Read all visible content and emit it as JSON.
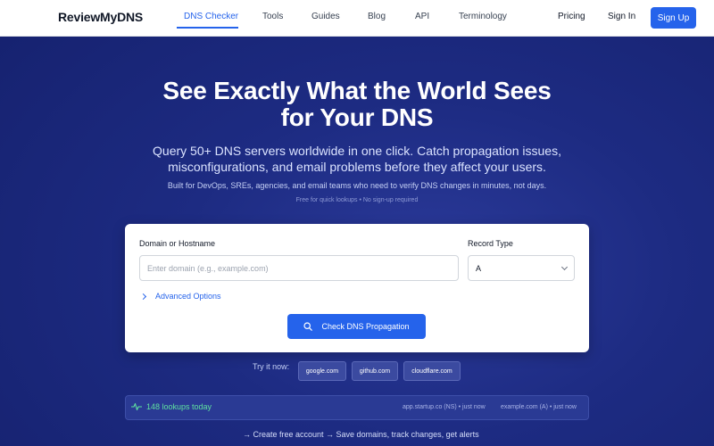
{
  "nav": {
    "brand": "ReviewMyDNS",
    "links": [
      "DNS Checker",
      "Tools",
      "Guides",
      "Blog",
      "API",
      "Terminology"
    ],
    "pricing": "Pricing",
    "sign_in": "Sign In",
    "sign_up": "Sign Up"
  },
  "hero": {
    "title_line1": "See Exactly What the World Sees",
    "title_line2": "for Your DNS",
    "subtitle_line1": "Query 50+ DNS servers worldwide in one click. Catch propagation issues,",
    "subtitle_line2": "misconfigurations, and email problems before they affect your users.",
    "built_for": "Built for DevOps, SREs, agencies, and email teams who need to verify DNS changes in minutes, not days.",
    "free_note": "Free for quick lookups • No sign-up required"
  },
  "form": {
    "domain_label": "Domain or Hostname",
    "domain_placeholder": "Enter domain (e.g., example.com)",
    "record_label": "Record Type",
    "record_value": "A",
    "advanced": "Advanced Options",
    "submit": "Check DNS Propagation"
  },
  "try_now": {
    "label": "Try it now:",
    "examples": [
      "google.com",
      "github.com",
      "cloudflare.com"
    ]
  },
  "activity": {
    "lookups": "148 lookups today",
    "recent": [
      "app.startup.co (NS) • just now",
      "example.com (A) • just now"
    ]
  },
  "cta": "→ Create free account → Save domains, track changes, get alerts",
  "colors": {
    "accent": "#2563eb",
    "hero_bg": "#1d2b82",
    "success": "#5fe0a0"
  }
}
